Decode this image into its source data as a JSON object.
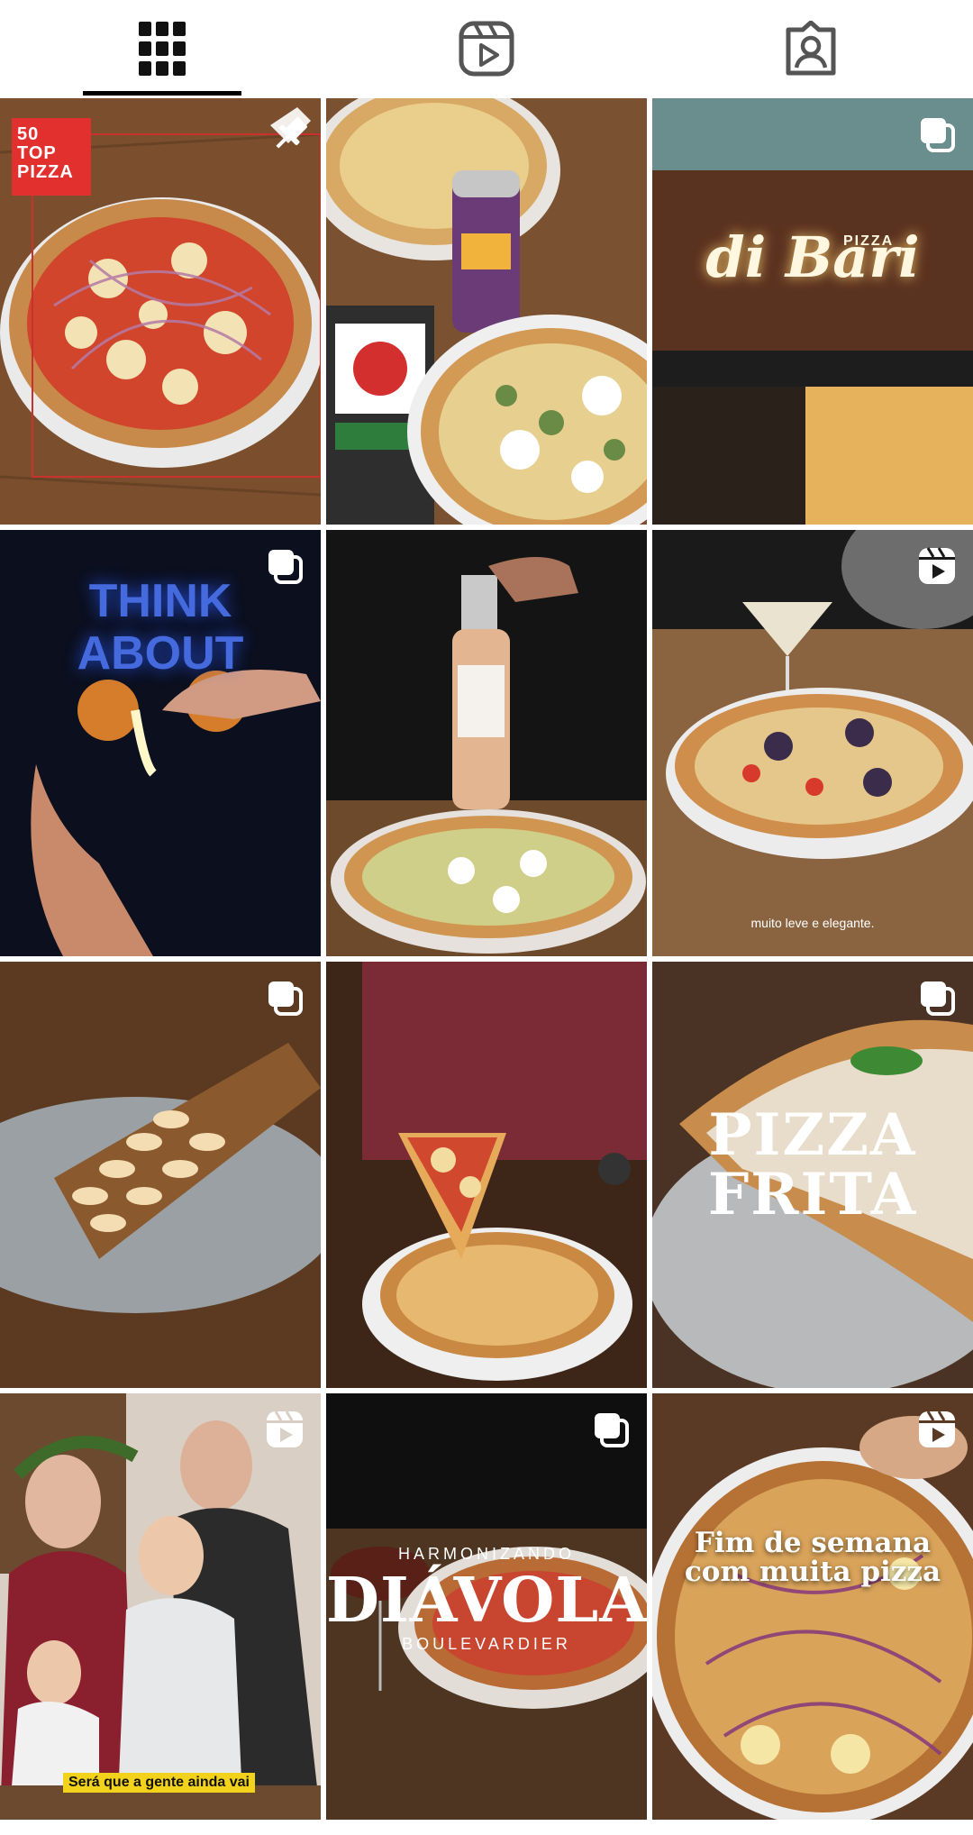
{
  "tabs": [
    {
      "icon": "grid-icon",
      "active": true
    },
    {
      "icon": "reels-icon",
      "active": false
    },
    {
      "icon": "tagged-icon",
      "active": false
    }
  ],
  "posts": {
    "p1": {
      "logo_line1": "50",
      "logo_line2": "TOP",
      "logo_line3": "PIZZA",
      "badge": "pin-icon"
    },
    "p2": {
      "badge": "none"
    },
    "p3": {
      "sign": "di Bari",
      "sign_small": "PIZZA",
      "badge": "carousel-icon"
    },
    "p4": {
      "neon": "THINK ABOUT",
      "badge": "carousel-icon"
    },
    "p5": {
      "badge": "none"
    },
    "p6": {
      "caption": "muito leve e elegante.",
      "badge": "reel-icon"
    },
    "p7": {
      "badge": "carousel-icon"
    },
    "p8": {
      "badge": "none"
    },
    "p9": {
      "title_line1": "PIZZA",
      "title_line2": "FRITA",
      "badge": "carousel-icon"
    },
    "p10": {
      "caption": "Será que a gente ainda vai",
      "badge": "reel-icon"
    },
    "p11": {
      "top": "HARMONIZANDO",
      "title": "DIÁVOLA",
      "sub": "BOULEVARDIER",
      "badge": "carousel-icon"
    },
    "p12": {
      "title_line1": "Fim de semana",
      "title_line2": "com muita pizza",
      "badge": "reel-icon"
    }
  },
  "colors": {
    "accent": "#000000",
    "logo_red": "#e2302f"
  }
}
